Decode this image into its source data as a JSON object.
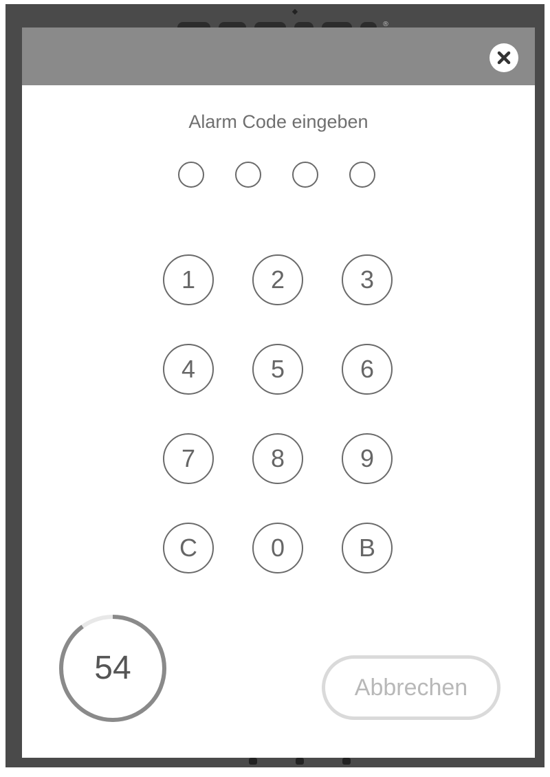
{
  "dialog": {
    "prompt": "Alarm Code eingeben",
    "close_icon": "close-icon",
    "pin_length": 4,
    "digits_entered": 0
  },
  "keypad": {
    "keys": [
      {
        "label": "1"
      },
      {
        "label": "2"
      },
      {
        "label": "3"
      },
      {
        "label": "4"
      },
      {
        "label": "5"
      },
      {
        "label": "6"
      },
      {
        "label": "7"
      },
      {
        "label": "8"
      },
      {
        "label": "9"
      },
      {
        "label": "C"
      },
      {
        "label": "0"
      },
      {
        "label": "B"
      }
    ]
  },
  "countdown": {
    "value": "54",
    "remaining_fraction": 0.9
  },
  "cancel_button": {
    "label": "Abbrechen"
  },
  "colors": {
    "header": "#8a8a8a",
    "overlay": "#4a4a4a",
    "key_border": "#6a6a6a",
    "countdown_ring": "#8a8a8a",
    "countdown_track": "#e8e8e8",
    "cancel_border": "#dadada"
  }
}
